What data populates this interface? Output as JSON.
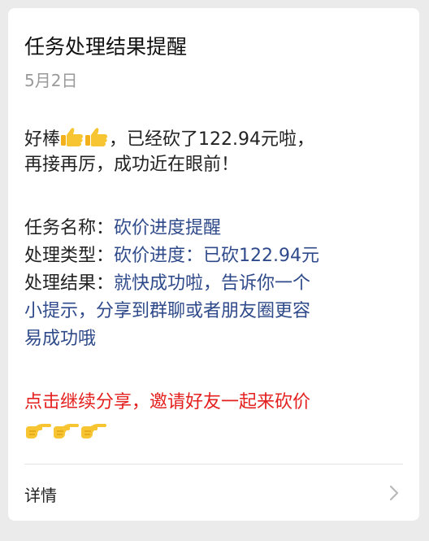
{
  "card": {
    "title": "任务处理结果提醒",
    "date": "5月2日"
  },
  "message": {
    "greeting_prefix": "好棒",
    "greeting_suffix": "，已经砍了122.94元啦，",
    "greeting_line2": "再接再厉，成功近在眼前！",
    "task_name_label": "任务名称：",
    "task_name_value": "砍价进度提醒",
    "process_type_label": "处理类型：",
    "process_type_value": "砍价进度：已砍122.94元",
    "process_result_label": "处理结果：",
    "process_result_line1": "就快成功啦，告诉你一个",
    "process_result_line2": "小提示，分享到群聊或者朋友圈更容",
    "process_result_line3": "易成功哦",
    "cta": "点击继续分享，邀请好友一起来砍价"
  },
  "footer": {
    "detail_label": "详情"
  },
  "icons": {
    "thumbs": "thumbs-up-icon",
    "pointing": "pointing-right-icon",
    "chevron": "chevron-right-icon"
  },
  "colors": {
    "label": "#222222",
    "value": "#2f4a8a",
    "cta": "#e4201f",
    "date": "#9a9a9a"
  }
}
